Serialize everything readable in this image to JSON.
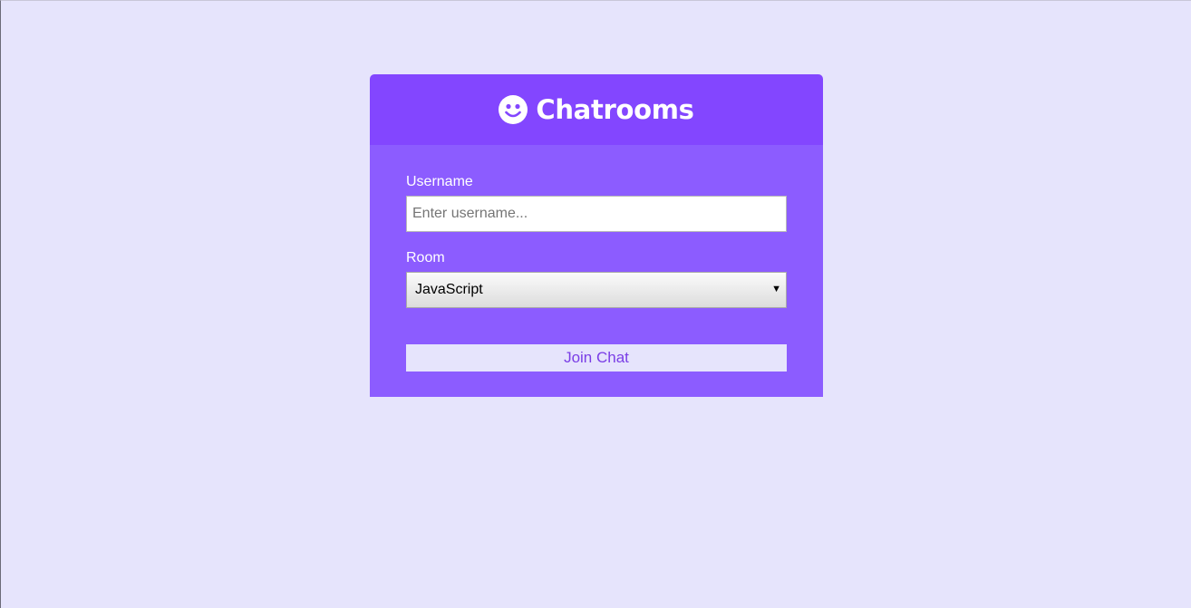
{
  "header": {
    "title": "Chatrooms",
    "icon": "smile-icon"
  },
  "form": {
    "username": {
      "label": "Username",
      "placeholder": "Enter username...",
      "value": ""
    },
    "room": {
      "label": "Room",
      "selected": "JavaScript"
    },
    "submit_label": "Join Chat"
  },
  "colors": {
    "page_background": "#e6e4fc",
    "header_background": "#8346ff",
    "form_background": "#8c5cff",
    "button_text": "#7a3ee6"
  }
}
